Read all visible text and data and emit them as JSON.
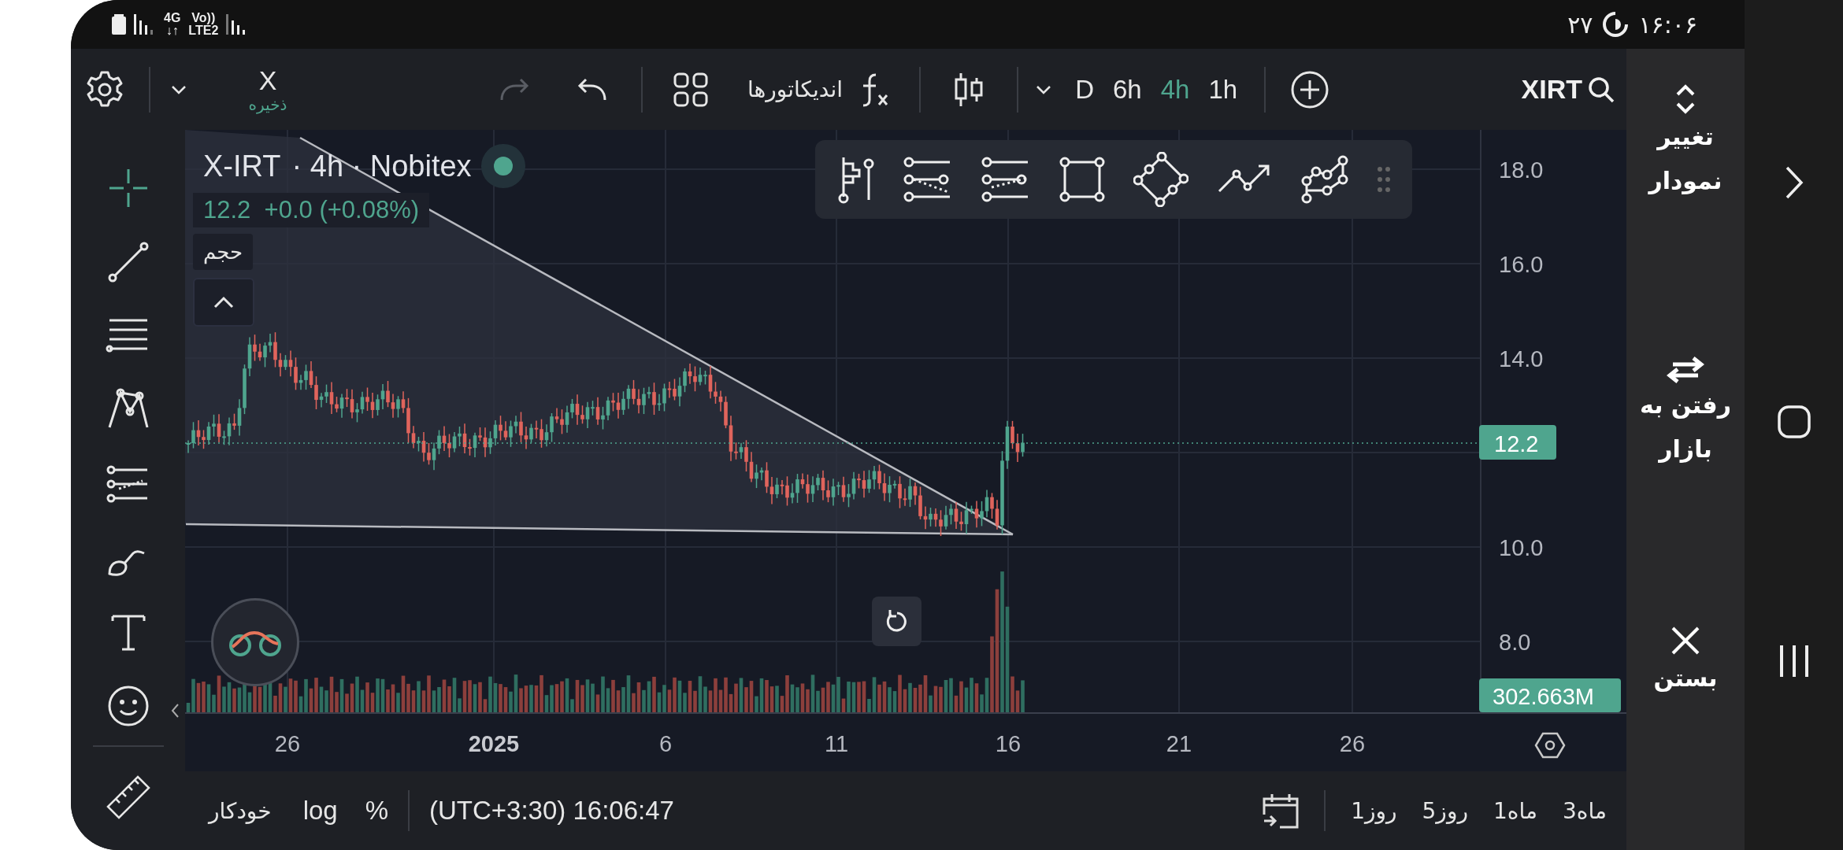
{
  "status_bar": {
    "network": "4G",
    "arrows": "↓↑",
    "volte": "Vo))",
    "lte": "LTE2",
    "date": "۲۷",
    "time": "۱۶:۰۶"
  },
  "toolbar": {
    "layout_name": "X",
    "save_label": "ذخیره",
    "redo": {
      "disabled": true
    },
    "indicators": "اندیکاتورها",
    "intervals": [
      {
        "label": "1h",
        "selected": false
      },
      {
        "label": "4h",
        "selected": true
      },
      {
        "label": "6h",
        "selected": false
      },
      {
        "label": "D",
        "selected": false
      }
    ],
    "symbol": "XIRT"
  },
  "left_tools": [
    {
      "kind": "crosshair",
      "selected": true
    },
    {
      "kind": "trendline",
      "selected": false
    },
    {
      "kind": "fib",
      "selected": false
    },
    {
      "kind": "pattern",
      "selected": false
    },
    {
      "kind": "forecast",
      "selected": false
    },
    {
      "kind": "brush",
      "selected": false
    },
    {
      "kind": "text",
      "selected": false
    },
    {
      "kind": "emoji",
      "selected": false
    },
    {
      "kind": "ruler",
      "selected": false
    }
  ],
  "legend": {
    "symbol": "X-IRT",
    "details": "· 4h · Nobitex",
    "price": "12.2",
    "change": "+0.0 (+0.08%)",
    "volume_label": "حجم"
  },
  "price_axis": {
    "ticks": [
      "18.0",
      "16.0",
      "14.0",
      "10.0",
      "8.0"
    ],
    "last_price": "12.2",
    "last_volume": "302.663M"
  },
  "time_axis": {
    "labels": [
      {
        "text": "26",
        "kind": "day"
      },
      {
        "text": "21",
        "kind": "day"
      },
      {
        "text": "16",
        "kind": "day"
      },
      {
        "text": "11",
        "kind": "day"
      },
      {
        "text": "6",
        "kind": "day"
      },
      {
        "text": "2025",
        "kind": "year"
      },
      {
        "text": "26",
        "kind": "day"
      }
    ]
  },
  "bottom_bar": {
    "auto": "خودکار",
    "log": "log",
    "percent": "%",
    "timezone": "(UTC+3:30) 16:06:47",
    "ranges": [
      "3ماه",
      "1ماه",
      "5روز",
      "1روز"
    ]
  },
  "side_panel": [
    {
      "kind": "switch",
      "label": "تغییر نمودار"
    },
    {
      "kind": "market",
      "label": "رفتن به بازار"
    },
    {
      "kind": "close",
      "label": "بستن"
    }
  ]
}
